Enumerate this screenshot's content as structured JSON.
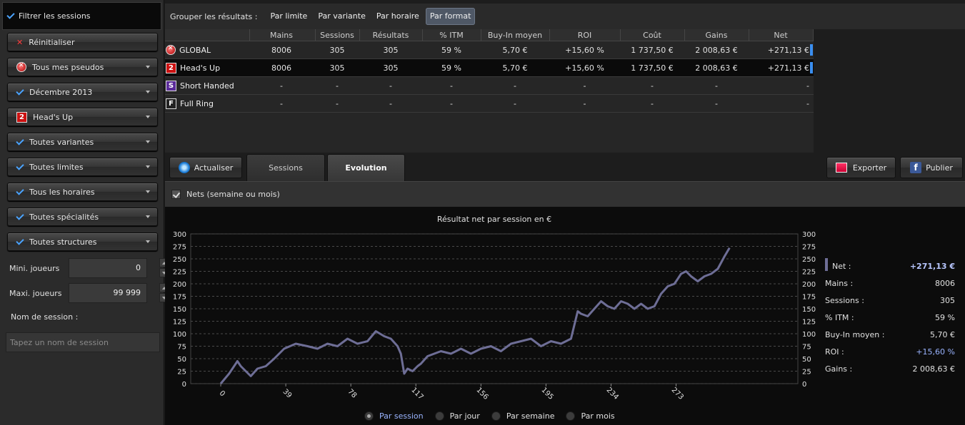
{
  "sidebar": {
    "header": "Filtrer les sessions",
    "buttons": [
      "Réinitialiser",
      "Tous mes pseudos",
      "Décembre 2013",
      "Head's Up",
      "Toutes variantes",
      "Toutes limites",
      "Tous les horaires",
      "Toutes spécialités",
      "Toutes structures"
    ],
    "headsup_badge": "2",
    "min_label": "Mini. joueurs",
    "min_value": "0",
    "max_label": "Maxi. joueurs",
    "max_value": "99 999",
    "name_label": "Nom de session :",
    "name_placeholder": "Tapez un nom de session"
  },
  "grouping": {
    "label": "Grouper les résultats :",
    "options": [
      "Par limite",
      "Par variante",
      "Par horaire",
      "Par format"
    ],
    "active": "Par format"
  },
  "table": {
    "headers": [
      "Mains",
      "Sessions",
      "Résultats",
      "% ITM",
      "Buy-In moyen",
      "ROI",
      "Coût",
      "Gains",
      "Net"
    ],
    "rows": [
      {
        "badge": "",
        "name": "GLOBAL",
        "cells": [
          "8006",
          "305",
          "305",
          "59 %",
          "5,70 €",
          "+15,60 %",
          "1 737,50 €",
          "2 008,63 €",
          "+271,13 €"
        ]
      },
      {
        "badge": "2",
        "name": "Head's Up",
        "cells": [
          "8006",
          "305",
          "305",
          "59 %",
          "5,70 €",
          "+15,60 %",
          "1 737,50 €",
          "2 008,63 €",
          "+271,13 €"
        ]
      },
      {
        "badge": "S",
        "name": "Short Handed",
        "cells": [
          "-",
          "-",
          "-",
          "-",
          "-",
          "-",
          "-",
          "-",
          "-"
        ]
      },
      {
        "badge": "F",
        "name": "Full Ring",
        "cells": [
          "-",
          "-",
          "-",
          "-",
          "-",
          "-",
          "-",
          "-",
          "-"
        ]
      }
    ]
  },
  "tabs": {
    "refresh": "Actualiser",
    "sessions": "Sessions",
    "evolution": "Evolution",
    "export": "Exporter",
    "publish": "Publier"
  },
  "nets_label": "Nets (semaine ou mois)",
  "stats": [
    {
      "k": "Net :",
      "v": "+271,13 €"
    },
    {
      "k": "Mains :",
      "v": "8006"
    },
    {
      "k": "Sessions :",
      "v": "305"
    },
    {
      "k": "% ITM :",
      "v": "59 %"
    },
    {
      "k": "Buy-In moyen :",
      "v": "5,70 €"
    },
    {
      "k": "ROI :",
      "v": "+15,60 %"
    },
    {
      "k": "Gains :",
      "v": "2 008,63 €"
    }
  ],
  "view_options": [
    "Par session",
    "Par jour",
    "Par semaine",
    "Par mois"
  ],
  "view_active": "Par session",
  "colors": {
    "line": "#6e6e96",
    "accent": "#3a8ef0",
    "active_text": "#9ab4ff"
  },
  "chart_data": {
    "type": "line",
    "title": "Résultat net par session en €",
    "xlabel": "",
    "ylabel": "",
    "ylim": [
      0,
      300
    ],
    "yticks": [
      0,
      25,
      50,
      75,
      100,
      125,
      150,
      175,
      200,
      225,
      250,
      275,
      300
    ],
    "xlim": [
      -18,
      346
    ],
    "xticks": [
      0,
      39,
      78,
      117,
      156,
      195,
      234,
      273
    ],
    "grid": true,
    "series": [
      {
        "name": "Net",
        "x": [
          0,
          5,
          10,
          12,
          15,
          18,
          22,
          27,
          32,
          38,
          45,
          52,
          58,
          64,
          70,
          76,
          82,
          88,
          93,
          98,
          102,
          106,
          108,
          110,
          112,
          115,
          118,
          120,
          124,
          128,
          132,
          138,
          144,
          150,
          156,
          162,
          168,
          174,
          180,
          186,
          192,
          198,
          204,
          210,
          214,
          216,
          220,
          224,
          228,
          232,
          236,
          240,
          244,
          248,
          252,
          256,
          260,
          264,
          268,
          272,
          274,
          276,
          279,
          282,
          286,
          290,
          294,
          298,
          302,
          305
        ],
        "y": [
          0,
          20,
          45,
          35,
          25,
          15,
          30,
          35,
          50,
          70,
          80,
          75,
          70,
          80,
          75,
          90,
          80,
          85,
          105,
          95,
          90,
          75,
          60,
          20,
          30,
          25,
          35,
          40,
          55,
          60,
          65,
          60,
          70,
          60,
          70,
          75,
          65,
          80,
          85,
          90,
          75,
          85,
          80,
          90,
          145,
          140,
          135,
          150,
          165,
          155,
          150,
          165,
          160,
          150,
          160,
          150,
          155,
          180,
          195,
          200,
          210,
          220,
          225,
          215,
          205,
          215,
          220,
          230,
          255,
          272
        ]
      }
    ]
  }
}
